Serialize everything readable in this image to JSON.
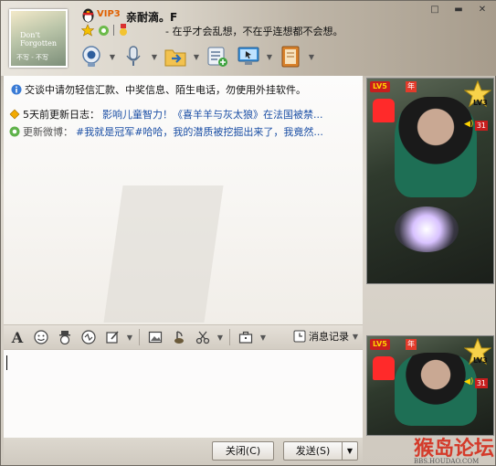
{
  "header": {
    "vip_label": "VIP3",
    "nickname": "亲耐滴。F",
    "signature": "- 在乎才会乱想，不在乎连想都不会想。",
    "avatar_caption_1": "Don't Forgotten",
    "avatar_caption_2": "不写 - 不写"
  },
  "window_buttons": [
    "□",
    "▬",
    "✕"
  ],
  "toolbar": {
    "items": [
      "video-chat",
      "voice-chat",
      "send-file",
      "apps",
      "remote-assist",
      "more"
    ]
  },
  "chat": {
    "notice": "交谈中请勿轻信汇款、中奖信息、陌生电话，勿使用外挂软件。",
    "blog_label": "5天前更新日志：",
    "blog_text": "影响儿童智力！《喜羊羊与灰太狼》在法国被禁...",
    "weibo_label": "更新微博：",
    "weibo_text": "#我就是冠军#哈哈，我的潜质被挖掘出来了，我竟然..."
  },
  "format_bar": {
    "history_label": "消息记录"
  },
  "buttons": {
    "close": "关闭(C)",
    "send": "发送(S)",
    "send_dropdown": "▼"
  },
  "video": {
    "level_badge": "LV5",
    "year_badge": "年",
    "lv3": "LV3",
    "count": "31"
  },
  "watermark": {
    "text": "猴岛论坛",
    "url": "BBS.HOUDAO.COM"
  },
  "colors": {
    "link": "#1b4fa5",
    "vip": "#e06000",
    "badge_red": "#c81e1e"
  }
}
